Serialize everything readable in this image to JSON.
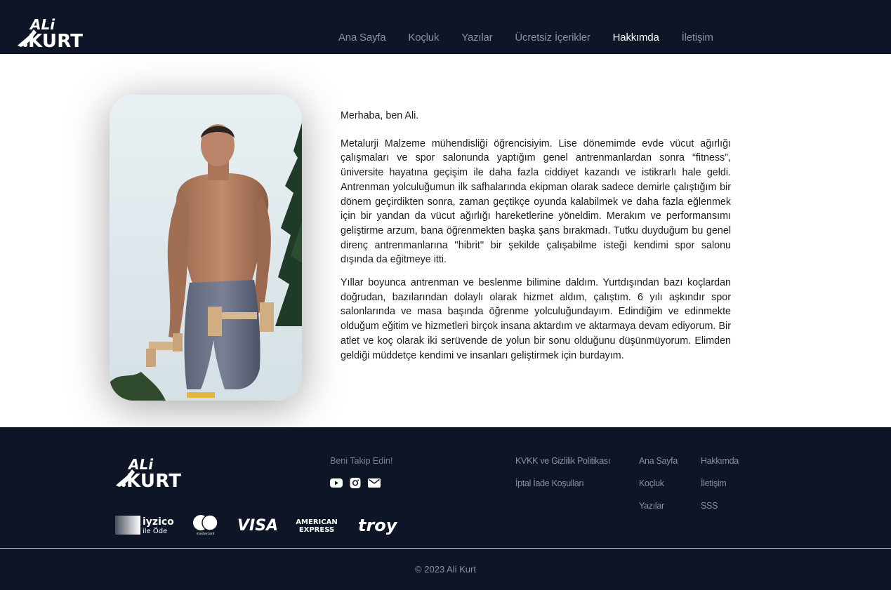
{
  "brand": {
    "logo_top": "ALi",
    "logo_bottom": "KURT"
  },
  "nav": {
    "items": [
      {
        "label": "Ana Sayfa",
        "active": false
      },
      {
        "label": "Koçluk",
        "active": false
      },
      {
        "label": "Yazılar",
        "active": false
      },
      {
        "label": "Ücretsiz İçerikler",
        "active": false
      },
      {
        "label": "Hakkımda",
        "active": true
      },
      {
        "label": "İletişim",
        "active": false
      }
    ]
  },
  "about": {
    "greeting": "Merhaba, ben Ali.",
    "paragraph1": "Metalurji Malzeme mühendisliği öğrencisiyim. Lise dönemimde evde vücut ağırlığı çalışmaları ve spor salonunda yaptığım genel antrenmanlardan sonra “fitness”, üniversite hayatına geçişim ile daha fazla ciddiyet kazandı ve istikrarlı hale geldi. Antrenman yolculuğumun ilk safhalarında ekipman olarak sadece demirle çalıştığım bir dönem geçirdikten sonra, zaman geçtikçe oyunda kalabilmek ve daha fazla eğlenmek için bir yandan da vücut ağırlığı hareketlerine yöneldim. Merakım ve performansımı geliştirme arzum, bana öğrenmekten başka şans bırakmadı. Tutku duyduğum bu genel direnç antrenmanlarına ''hibrit'' bir şekilde çalışabilme isteği kendimi spor salonu dışında da eğitmeye itti.",
    "paragraph2": "Yıllar boyunca antrenman ve beslenme bilimine daldım. Yurtdışından bazı koçlardan doğrudan, bazılarından dolaylı olarak hizmet aldım, çalıştım. 6 yılı aşkındır spor salonlarında ve masa başında öğrenme yolculuğundayım. Edindiğim ve edinmekte olduğum eğitim ve hizmetleri birçok insana aktardım ve aktarmaya devam ediyorum. Bir atlet ve koç olarak iki serüvende de yolun bir sonu olduğunu düşünmüyorum. Elimden geldiği müddetçe kendimi ve insanları geliştirmek için burdayım."
  },
  "footer": {
    "follow_label": "Beni Takip Edin!",
    "socials": [
      "youtube-icon",
      "instagram-icon",
      "mail-icon"
    ],
    "legal_links": [
      "KVKK ve Gizlilik Politikası",
      "İptal İade Koşulları"
    ],
    "col1_links": [
      "Ana Sayfa",
      "Koçluk",
      "Yazılar"
    ],
    "col2_links": [
      "Hakkımda",
      "İletişim",
      "SSS"
    ],
    "payment": {
      "iyzico_name": "iyzico",
      "iyzico_sub": "ile Öde",
      "mastercard": "mastercard",
      "visa": "VISA",
      "amex_top": "AMERICAN",
      "amex_bottom": "EXPRESS",
      "troy": "troy"
    },
    "copyright": "© 2023 Ali Kurt"
  },
  "colors": {
    "dark": "#0d1526",
    "nav_inactive": "#8a909c",
    "nav_active": "#ffffff"
  }
}
